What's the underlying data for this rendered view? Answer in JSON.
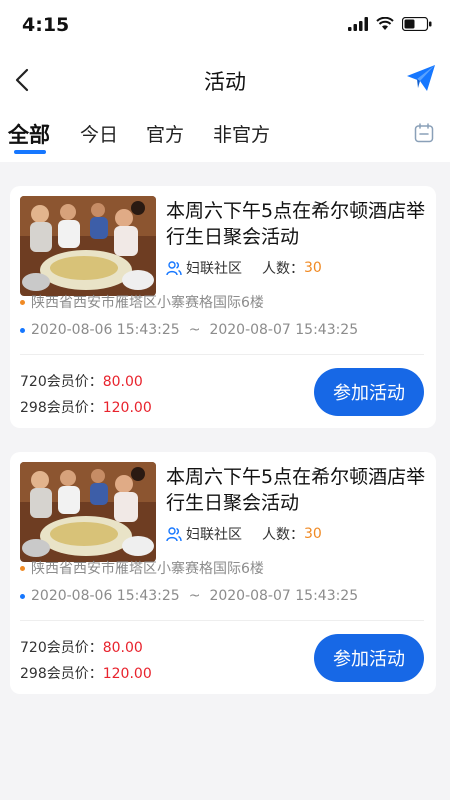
{
  "status": {
    "time": "4:15"
  },
  "nav": {
    "title": "活动"
  },
  "tabs": [
    {
      "label": "全部",
      "active": true
    },
    {
      "label": "今日",
      "active": false
    },
    {
      "label": "官方",
      "active": false
    },
    {
      "label": "非官方",
      "active": false
    }
  ],
  "colors": {
    "accent": "#1677ff",
    "button": "#1768e6",
    "price": "#e8232d",
    "count": "#f08a24"
  },
  "activities": [
    {
      "title": "本周六下午5点在希尔顿酒店举行生日聚会活动",
      "org": "妇联社区",
      "count_label": "人数：",
      "count": "30",
      "address": "陕西省西安市雁塔区小寨赛格国际6楼",
      "start": "2020-08-06 15:43:25",
      "sep": "~",
      "end": "2020-08-07 15:43:25",
      "price1_label": "720会员价：",
      "price1": "80.00",
      "price2_label": "298会员价：",
      "price2": "120.00",
      "button": "参加活动"
    },
    {
      "title": "本周六下午5点在希尔顿酒店举行生日聚会活动",
      "org": "妇联社区",
      "count_label": "人数：",
      "count": "30",
      "address": "陕西省西安市雁塔区小寨赛格国际6楼",
      "start": "2020-08-06 15:43:25",
      "sep": "~",
      "end": "2020-08-07 15:43:25",
      "price1_label": "720会员价：",
      "price1": "80.00",
      "price2_label": "298会员价：",
      "price2": "120.00",
      "button": "参加活动"
    }
  ]
}
